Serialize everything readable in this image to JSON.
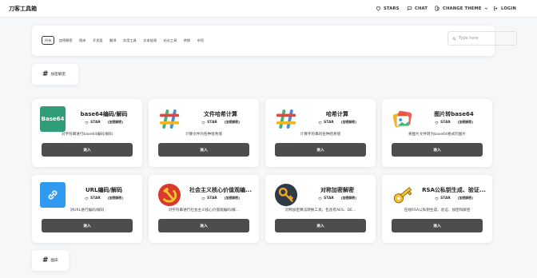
{
  "header": {
    "brand": "刀客工具箱",
    "stars_label": "STARS",
    "chat_label": "CHAT",
    "theme_label": "CHANGE THEME",
    "login_label": "LOGIN"
  },
  "filter": {
    "chips": [
      "所有",
      "加密解密",
      "图床",
      "开发类",
      "翻译",
      "实用工具",
      "文本处理",
      "站长工具",
      "转换",
      "杂项"
    ],
    "active_chip": 0,
    "search_placeholder": "Type here"
  },
  "sections": {
    "crypto": "加密解密",
    "imagehost": "图床"
  },
  "cards": [
    {
      "title": "base64编码/解码",
      "star": "STAR",
      "tag": "[加密解密]",
      "desc": "对字符串进行base64编码/解码",
      "button": "进入",
      "logo_text": "Base64",
      "logo_color": "#2f9d78"
    },
    {
      "title": "文件哈希计算",
      "star": "STAR",
      "tag": "[加密解密]",
      "desc": "计算文件的各种哈希值",
      "button": "进入"
    },
    {
      "title": "哈希计算",
      "star": "STAR",
      "tag": "[加密解密]",
      "desc": "计算字符串的各种哈希值",
      "button": "进入"
    },
    {
      "title": "图片转base64",
      "star": "STAR",
      "tag": "[加密解密]",
      "desc": "将图片文件转为base64格式的图片",
      "button": "进入"
    },
    {
      "title": "URL编码/解码",
      "star": "STAR",
      "tag": "[加密解密]",
      "desc": "对URL进行编码/解码",
      "button": "进入",
      "logo_color": "#2f9af0"
    },
    {
      "title": "社会主义核心价值观编...",
      "star": "STAR",
      "tag": "[加密解密]",
      "desc": "对字符串进行社会主义核心价值观编码/解...",
      "button": "进入"
    },
    {
      "title": "对称加密解密",
      "star": "STAR",
      "tag": "[加密解密]",
      "desc": "对称加密算法转换工具，包含有AES、DE...",
      "button": "进入"
    },
    {
      "title": "RSA公私钥生成、验证...",
      "star": "STAR",
      "tag": "[加密解密]",
      "desc": "在线RSA公私钥生成、验证、加密和解密",
      "button": "进入"
    }
  ],
  "colors": {
    "button_bg": "#4d4d4d",
    "hash_red": "#e8433d",
    "hash_yellow": "#f2b51f",
    "hash_blue": "#3c8fe0",
    "hash_green": "#3fb37a"
  }
}
